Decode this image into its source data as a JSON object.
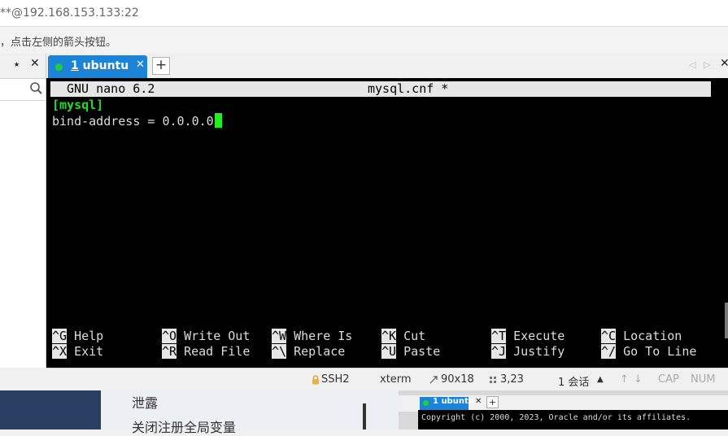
{
  "window": {
    "title": "**@192.168.153.133:22"
  },
  "hint": {
    "text": "，点击左侧的箭头按钮。"
  },
  "left_panel": {
    "pin_glyph": "⭑",
    "close_glyph": "✕",
    "search_icon": "search-icon"
  },
  "tabs": [
    {
      "number": "1",
      "name": " ubuntu",
      "close_glyph": "✕",
      "status_color": "#22cc44"
    }
  ],
  "tab_add_glyph": "+",
  "tab_nav": {
    "prev": "◁",
    "next": "▷",
    "close": "✕"
  },
  "nano": {
    "version": "GNU nano 6.2",
    "filename": "mysql.cnf *",
    "lines": [
      {
        "text": "[mysql]"
      },
      {
        "text": "bind-address = 0.0.0.0"
      }
    ],
    "shortcuts": [
      [
        {
          "key": "^G",
          "label": "Help"
        },
        {
          "key": "^X",
          "label": "Exit"
        }
      ],
      [
        {
          "key": "^O",
          "label": "Write Out"
        },
        {
          "key": "^R",
          "label": "Read File"
        }
      ],
      [
        {
          "key": "^W",
          "label": "Where Is"
        },
        {
          "key": "^\\",
          "label": "Replace"
        }
      ],
      [
        {
          "key": "^K",
          "label": "Cut"
        },
        {
          "key": "^U",
          "label": "Paste"
        }
      ],
      [
        {
          "key": "^T",
          "label": "Execute"
        },
        {
          "key": "^J",
          "label": "Justify"
        }
      ],
      [
        {
          "key": "^C",
          "label": "Location"
        },
        {
          "key": "^/",
          "label": "Go To Line"
        }
      ]
    ]
  },
  "status": {
    "protocol": "SSH2",
    "terminal": "xterm",
    "size": "90x18",
    "cursor": "3,23",
    "sessions": "1 会话",
    "caps": "CAP",
    "num": "NUM",
    "lock_icon": "lock-icon",
    "up_arrow": "▲",
    "nav_up": "↑",
    "nav_down": "↓"
  },
  "background": {
    "line1": "泄露",
    "line2": "关闭注册全局变量",
    "mini_tab": "1 ubuntu",
    "mini_close": "✕",
    "mini_add": "+",
    "copyright": "Copyright (c) 2000, 2023, Oracle and/or its affiliates."
  },
  "colors": {
    "accent": "#1b84d6",
    "cursor_green": "#22ee22",
    "section_green": "#22dd22"
  }
}
